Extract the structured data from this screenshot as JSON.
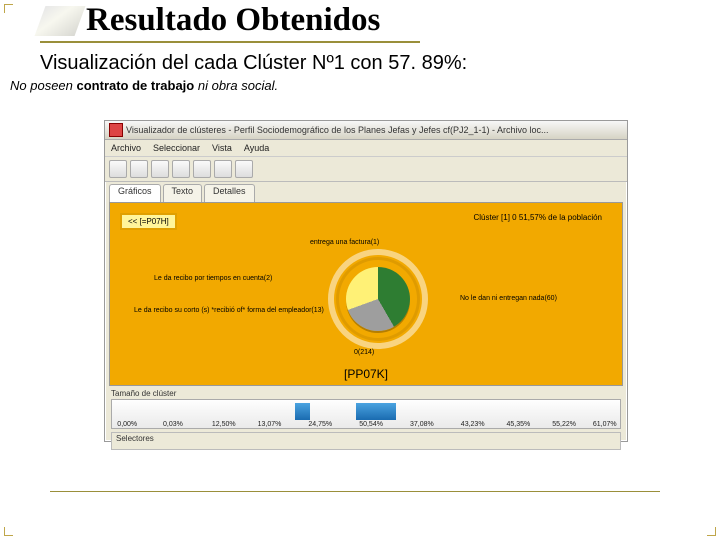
{
  "slide": {
    "title": "Resultado Obtenidos",
    "subtitle": "Visualización del cada Clúster Nº1 con 57. 89%:",
    "note_pre": "No poseen ",
    "note_bold": "contrato de trabajo",
    "note_post": " ni obra social."
  },
  "window": {
    "title": "Visualizador de clústeres - Perfil Sociodemográfico de los Planes Jefas y Jefes cf(PJ2_1-1) - Archivo loc...",
    "menus": [
      "Archivo",
      "Seleccionar",
      "Vista",
      "Ayuda"
    ],
    "tabs": [
      "Gráficos",
      "Texto",
      "Detalles"
    ],
    "back_button": "<< [=P07H]",
    "cluster_info": "Clúster [1] 0  51,57% de la población",
    "labels": {
      "top": "entrega una factura(1)",
      "left1": "Le da recibo por tiempos en cuenta(2)",
      "left2": "Le da recibo su corto (s) *recibió of* forma del empleador(13)",
      "bottom": "0(214)",
      "right": "No le dan ni entregan nada(60)"
    },
    "caption": "[PP07K]",
    "size_label": "Tamaño de clúster",
    "ticks": [
      "0,00%",
      "0,03%",
      "12,50%",
      "13,07%",
      "24,75%",
      "50,54%",
      "37,08%",
      "43,23%",
      "45,35%",
      "55,22%",
      "61,07%"
    ],
    "status": "Selectores"
  },
  "chart_data": {
    "type": "pie",
    "title": "[PP07K]",
    "series": [
      {
        "name": "No le dan ni entregan nada(60)",
        "value": 42
      },
      {
        "name": "0(214)",
        "value": 28
      },
      {
        "name": "entrega una factura(1) / recibo",
        "value": 30
      }
    ],
    "context": "Clúster 1 — 51,57% de la población"
  }
}
